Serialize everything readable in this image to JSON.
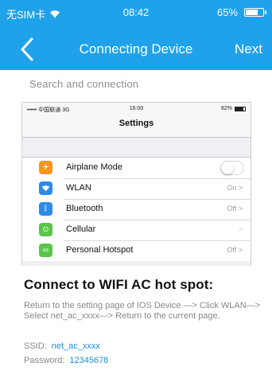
{
  "status_bar": {
    "carrier": "无SIM卡",
    "time": "08:42",
    "battery": "65%",
    "battery_level": 0.65
  },
  "nav": {
    "title": "Connecting Device",
    "next_label": "Next"
  },
  "section_heading": "Search and connection",
  "screenshot": {
    "status": {
      "carrier": "••••• 中国联通  3G",
      "time": "16:00",
      "battery": "82%",
      "battery_level": 0.82
    },
    "title": "Settings",
    "rows": [
      {
        "label": "Airplane Mode",
        "value": "",
        "icon": "airplane-icon",
        "color": "#f7931e"
      },
      {
        "label": "WLAN",
        "value": "On",
        "icon": "wifi-icon",
        "color": "#2d8ae6"
      },
      {
        "label": "Bluetooth",
        "value": "Off",
        "icon": "bluetooth-icon",
        "color": "#2d8ae6"
      },
      {
        "label": "Cellular",
        "value": "",
        "icon": "cellular-icon",
        "color": "#5bc44b"
      },
      {
        "label": "Personal Hotspot",
        "value": "Off",
        "icon": "hotspot-icon",
        "color": "#5bc44b"
      }
    ]
  },
  "info": {
    "title": "Connect to WIFI AC hot spot:",
    "description": "Return to the setting page of IOS Device —> Click WLAN—> Select net_ac_xxxx—> Return to the current page.",
    "ssid_label": "SSID:",
    "ssid_value": "net_ac_xxxx",
    "password_label": "Password:",
    "password_value": "12345678"
  },
  "colors": {
    "accent": "#1fa2ea",
    "link": "#1a8fd8"
  }
}
